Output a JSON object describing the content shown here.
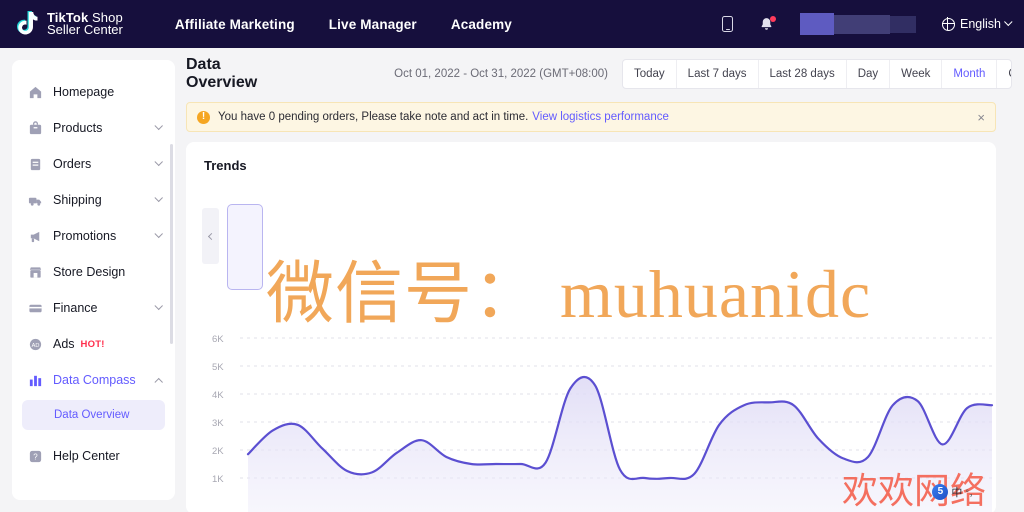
{
  "topnav": {
    "brand_line1_bold": "TikTok",
    "brand_line1_light": " Shop",
    "brand_line2": "Seller Center",
    "menu": [
      {
        "label": "Affiliate Marketing"
      },
      {
        "label": "Live Manager"
      },
      {
        "label": "Academy"
      }
    ],
    "phone_icon": "phone-icon",
    "bell_icon": "bell-icon",
    "notification_dot": true,
    "account_redacted": true,
    "language": "English",
    "globe_icon": "globe-icon",
    "chevron_icon": "chevron-down-icon",
    "bg_color": "#160f3d"
  },
  "sidebar": {
    "items": [
      {
        "label": "Homepage",
        "icon": "home-icon",
        "expandable": false,
        "active": false
      },
      {
        "label": "Products",
        "icon": "bag-icon",
        "expandable": true,
        "active": false
      },
      {
        "label": "Orders",
        "icon": "clipboard-icon",
        "expandable": true,
        "active": false
      },
      {
        "label": "Shipping",
        "icon": "truck-icon",
        "expandable": true,
        "active": false
      },
      {
        "label": "Promotions",
        "icon": "megaphone-icon",
        "expandable": true,
        "active": false
      },
      {
        "label": "Store Design",
        "icon": "storefront-icon",
        "expandable": false,
        "active": false
      },
      {
        "label": "Finance",
        "icon": "card-icon",
        "expandable": true,
        "active": false
      },
      {
        "label": "Ads",
        "icon": "ads-icon",
        "expandable": false,
        "active": false,
        "badge": "HOT!"
      },
      {
        "label": "Data Compass",
        "icon": "bar-chart-icon",
        "expandable": true,
        "active": true,
        "expanded": true
      },
      {
        "label": "Help Center",
        "icon": "help-icon",
        "expandable": false,
        "active": false
      }
    ],
    "subitem": {
      "label": "Data Overview",
      "active": true
    },
    "active_color": "#635bff"
  },
  "header": {
    "title": "Data Overview",
    "date_range": "Oct 01, 2022 - Oct 31, 2022 (GMT+08:00)",
    "filters": [
      {
        "label": "Today",
        "active": false
      },
      {
        "label": "Last 7 days",
        "active": false
      },
      {
        "label": "Last 28 days",
        "active": false
      },
      {
        "label": "Day",
        "active": false
      },
      {
        "label": "Week",
        "active": false
      },
      {
        "label": "Month",
        "active": true
      },
      {
        "label": "Custom",
        "active": false
      }
    ]
  },
  "alert": {
    "icon": "warning-icon",
    "message": "You have 0 pending orders, Please take note and act in time.",
    "link_label": "View logistics performance",
    "close_label": "×",
    "bg_color": "#fdf6e3",
    "border_color": "#f7e5b6"
  },
  "main": {
    "card_title": "Trends",
    "prev_arrow": "chevron-left-icon",
    "metric_card_selected": true
  },
  "watermarks": {
    "orange_text": "微信号： muhuanidc",
    "orange_color": "#f0a04b",
    "red_text": "欢欢网络",
    "red_color": "#f4614f",
    "ime_lang": "中",
    "ime_dot": "°，"
  },
  "chart_data": {
    "type": "area",
    "title": "Trends",
    "xlabel": "",
    "ylabel": "",
    "grid": true,
    "legend": "none",
    "line_color": "#5b4fd1",
    "fill_color": "#e7e5f7",
    "ytick_labels": [
      "6K",
      "5K",
      "4K",
      "3K",
      "2K",
      "1K"
    ],
    "yticks": [
      6000,
      5000,
      4000,
      3000,
      2000,
      1000
    ],
    "ylim": [
      0,
      6500
    ],
    "x": [
      1,
      2,
      3,
      4,
      5,
      6,
      7,
      8,
      9,
      10,
      11,
      12,
      13,
      14,
      15,
      16,
      17,
      18,
      19,
      20,
      21,
      22,
      23,
      24,
      25,
      26,
      27,
      28,
      29,
      30,
      31
    ],
    "values": [
      1850,
      2700,
      2900,
      2050,
      1250,
      1200,
      1900,
      2350,
      1750,
      1500,
      1500,
      1500,
      1550,
      4200,
      4300,
      1300,
      1000,
      1000,
      1150,
      2900,
      3600,
      3700,
      3600,
      2400,
      1700,
      1750,
      3600,
      3750,
      2200,
      3500,
      3600
    ]
  }
}
